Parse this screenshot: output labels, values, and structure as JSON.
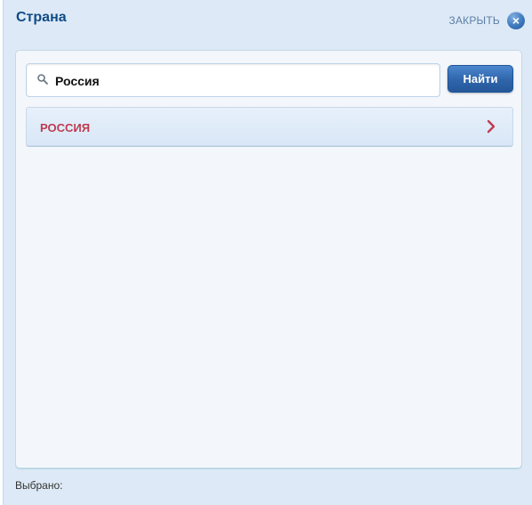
{
  "dialog": {
    "title": "Страна",
    "close_label": "ЗАКРЫТЬ"
  },
  "search": {
    "value": "Россия",
    "button_label": "Найти"
  },
  "results": [
    {
      "label": "РОССИЯ"
    }
  ],
  "footer": {
    "selected_label": "Выбрано:"
  },
  "colors": {
    "accent": "#0f4c86",
    "result_text": "#bf3c51",
    "button": "#2f65aa"
  },
  "icons": {
    "search": "search-icon",
    "close": "close-icon",
    "result_arrow": "chevron-right-icon"
  }
}
